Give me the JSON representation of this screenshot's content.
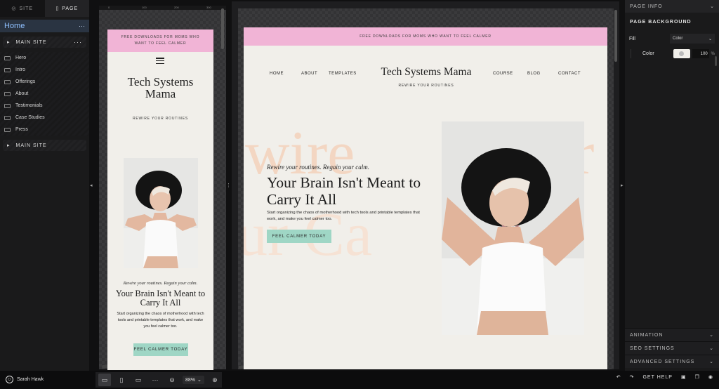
{
  "left_panel": {
    "tabs": [
      {
        "label": "SITE",
        "icon": "globe-icon"
      },
      {
        "label": "PAGE",
        "icon": "page-icon"
      }
    ],
    "home": {
      "label": "Home",
      "menu": "···"
    },
    "groups": [
      {
        "label": "MAIN SITE",
        "menu": "···"
      },
      {
        "label": "MAIN SITE"
      }
    ],
    "sections": [
      "Hero",
      "Intro",
      "Offerings",
      "About",
      "Testimonials",
      "Case Studies",
      "Press"
    ]
  },
  "mobile_preview": {
    "ruler": [
      "0",
      "100",
      "200",
      "300"
    ],
    "banner": "FREE DOWNLOADS FOR MOMS WHO WANT TO FEEL CALMER",
    "logo": "Tech Systems Mama",
    "tagline": "REWIRE YOUR ROUTINES",
    "kicker": "Rewire your routines. Regain your calm.",
    "headline": "Your Brain Isn't Meant to Carry It All",
    "body": "Start organizing the chaos of motherhood with tech tools and printable templates that work, and make you feel calmer too.",
    "cta": "FEEL CALMER TODAY"
  },
  "desktop_preview": {
    "banner": "FREE DOWNLOADS FOR MOMS WHO WANT TO FEEL CALMER",
    "nav_left": [
      "HOME",
      "ABOUT",
      "TEMPLATES"
    ],
    "nav_right": [
      "COURSE",
      "BLOG",
      "CONTACT"
    ],
    "logo": "Tech Systems Mama",
    "tagline": "REWIRE YOUR ROUTINES",
    "bg_words": [
      "wire",
      "r",
      "ur Ca"
    ],
    "kicker": "Rewire your routines. Regain your calm.",
    "headline": "Your Brain Isn't Meant to Carry It All",
    "body": "Start organizing the chaos of motherhood with tech tools and printable templates that work, and make you feel calmer too.",
    "cta": "FEEL CALMER TODAY"
  },
  "right_panel": {
    "page_info": "PAGE INFO",
    "page_background": "PAGE BACKGROUND",
    "fill_label": "Fill",
    "fill_value": "Color",
    "color_label": "Color",
    "opacity": "100",
    "opacity_unit": "%",
    "accordions": [
      "ANIMATION",
      "SEO SETTINGS",
      "ADVANCED SETTINGS"
    ]
  },
  "bottom_bar": {
    "user": "Sarah Hawk",
    "zoom": "88%",
    "help": "GET HELP"
  },
  "colors": {
    "banner": "#f1b4d6",
    "cta": "#9fd6c5",
    "page_bg": "#f1efea",
    "bg_script": "#f3d6c2"
  }
}
